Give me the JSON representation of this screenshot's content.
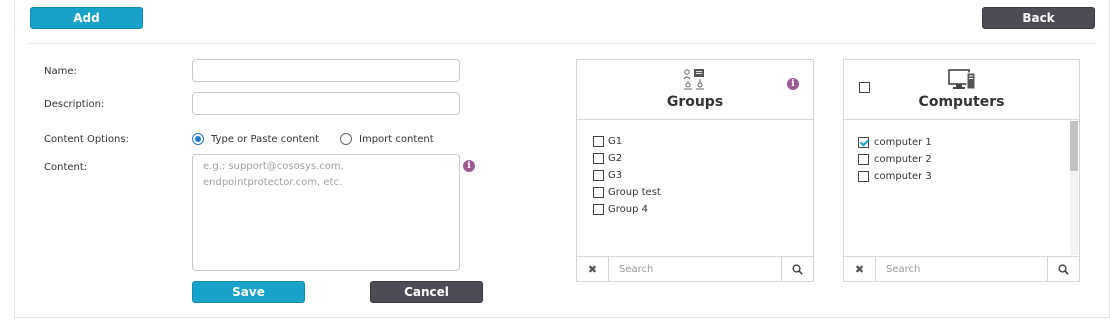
{
  "toolbar": {
    "add_label": "Add",
    "back_label": "Back"
  },
  "form": {
    "name_label": "Name:",
    "name_value": "",
    "description_label": "Description:",
    "description_value": "",
    "content_options_label": "Content Options:",
    "content_options": [
      {
        "label": "Type or Paste content",
        "selected": true
      },
      {
        "label": "Import content",
        "selected": false
      }
    ],
    "content_label": "Content:",
    "content_placeholder": "e.g.: support@cososys.com,\nendpointprotector.com, etc.",
    "info_symbol": "i",
    "save_label": "Save",
    "cancel_label": "Cancel"
  },
  "groups_panel": {
    "title": "Groups",
    "icon": "groups-icon",
    "info_symbol": "i",
    "items": [
      {
        "label": "G1",
        "checked": false
      },
      {
        "label": "G2",
        "checked": false
      },
      {
        "label": "G3",
        "checked": false
      },
      {
        "label": "Group test",
        "checked": false
      },
      {
        "label": "Group 4",
        "checked": false
      }
    ],
    "clear_symbol": "✖",
    "search_placeholder": "Search"
  },
  "computers_panel": {
    "title": "Computers",
    "icon": "computer-icon",
    "select_all_checked": false,
    "items": [
      {
        "label": "computer 1",
        "checked": true
      },
      {
        "label": "computer 2",
        "checked": false
      },
      {
        "label": "computer 3",
        "checked": false
      }
    ],
    "clear_symbol": "✖",
    "search_placeholder": "Search"
  },
  "colors": {
    "primary": "#17a2c9",
    "dark": "#4d4b55",
    "info": "#9c5a93",
    "radio": "#2478c9"
  }
}
